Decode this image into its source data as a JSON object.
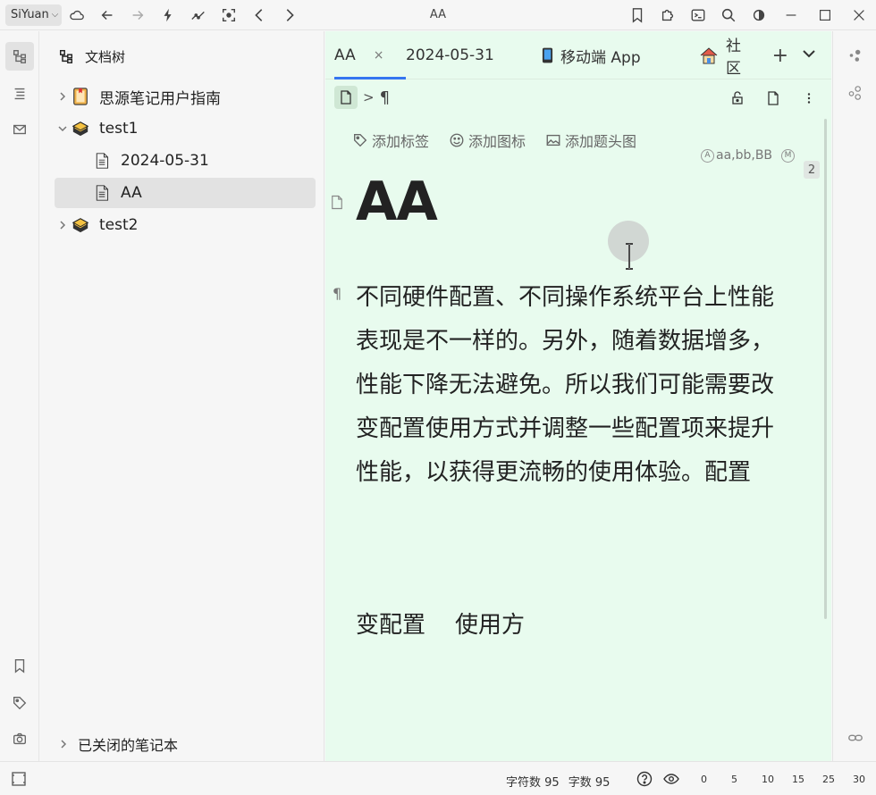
{
  "workspace": {
    "name": "SiYuan"
  },
  "window": {
    "title": "AA"
  },
  "tree": {
    "header": "文档树",
    "items": [
      {
        "label": "思源笔记用户指南",
        "type": "notebook-guide"
      },
      {
        "label": "test1",
        "type": "notebook"
      },
      {
        "label": "2024-05-31",
        "type": "doc"
      },
      {
        "label": "AA",
        "type": "doc"
      },
      {
        "label": "test2",
        "type": "notebook"
      }
    ],
    "closed_notebooks": "已关闭的笔记本"
  },
  "tabs": [
    {
      "label": "AA",
      "close": "×"
    },
    {
      "label": "2024-05-31"
    },
    {
      "label": "移动端 App"
    },
    {
      "label": "社区"
    }
  ],
  "tabs_plus": "+",
  "breadcrumb": {
    "separator": ">",
    "paragraph_mark": "¶"
  },
  "doc_actions": {
    "tag": "添加标签",
    "icon": "添加图标",
    "cover": "添加题头图"
  },
  "attrs": {
    "alias_badge": "A",
    "alias": "aa,bb,BB",
    "memo_badge": "M",
    "backlinks": "2"
  },
  "doc": {
    "title": "AA",
    "gutter_para": "¶",
    "paragraph": "不同硬件配置、不同操作系统平台上性能表现是不一样的。另外，随着数据增多，性能下降无法避免。所以我们可能需要改变配置使用方式并调整一些配置项来提升性能，以获得更流畅的使用体验。配置",
    "paragraph2": "变配置    使用方"
  },
  "status": {
    "chars": "字符数 95",
    "words": "字数 95",
    "zoom_marks": [
      "0",
      "5",
      "10",
      "15",
      "25",
      "30"
    ]
  }
}
